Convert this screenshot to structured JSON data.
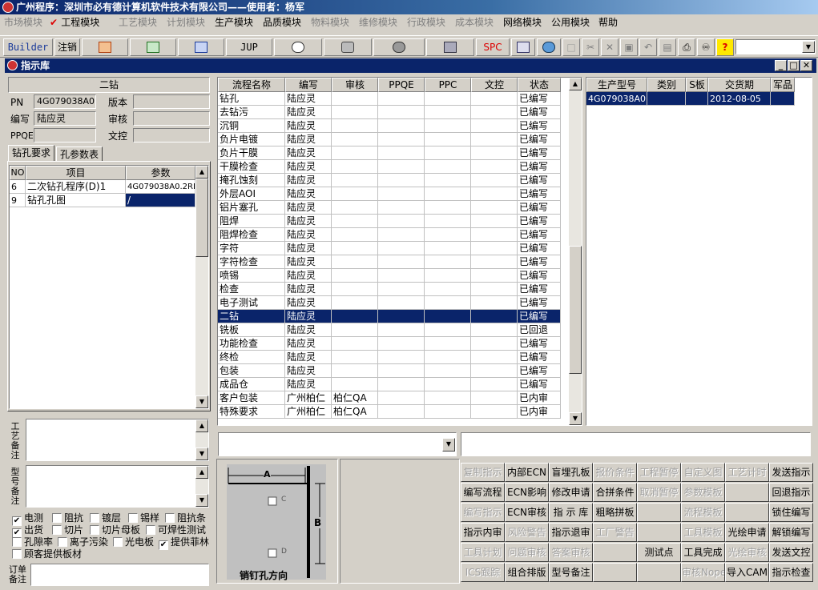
{
  "app": {
    "title": "广州程序：深圳市必有德计算机软件技术有限公司——使用者：杨军"
  },
  "menu": [
    {
      "label": "市场模块",
      "enabled": false
    },
    {
      "label": "工程模块",
      "enabled": true,
      "checked": true
    },
    {
      "label": "工艺模块",
      "enabled": false
    },
    {
      "label": "计划模块",
      "enabled": false
    },
    {
      "label": "生产模块",
      "enabled": true
    },
    {
      "label": "品质模块",
      "enabled": true
    },
    {
      "label": "物料模块",
      "enabled": false
    },
    {
      "label": "维修模块",
      "enabled": false
    },
    {
      "label": "行政模块",
      "enabled": false
    },
    {
      "label": "成本模块",
      "enabled": false
    },
    {
      "label": "网络模块",
      "enabled": true
    },
    {
      "label": "公用模块",
      "enabled": true
    },
    {
      "label": "帮助",
      "enabled": true
    }
  ],
  "toolbar": {
    "builder": "Builder",
    "logout": "注销",
    "jup": "JUP",
    "spc": "SPC"
  },
  "window": {
    "title": "指示库"
  },
  "left": {
    "heading": "二钻",
    "pn_label": "PN",
    "pn_value": "4G079038A0",
    "version_label": "版本",
    "version_value": "",
    "author_label": "编写",
    "author_value": "陆应灵",
    "review_label": "审核",
    "review_value": "",
    "ppqe_label": "PPQE",
    "ppqe_value": "",
    "doc_label": "文控",
    "doc_value": "",
    "tabs": [
      "钻孔要求",
      "孔参数表"
    ],
    "grid_headers": [
      "NO",
      "项目",
      "参数"
    ],
    "grid_rows": [
      {
        "no": "6",
        "item": "二次钻孔程序(D)1",
        "param": "4G079038A0.2RD"
      },
      {
        "no": "9",
        "item": "钻孔孔图",
        "param": "/"
      }
    ],
    "process_note_label": "工艺备注",
    "model_note_label": "型号备注",
    "order_note_label": "订单备注",
    "checks": [
      {
        "label": "电测",
        "checked": true
      },
      {
        "label": "阻抗",
        "checked": false
      },
      {
        "label": "镀层",
        "checked": false
      },
      {
        "label": "锡样",
        "checked": false
      },
      {
        "label": "阻抗条",
        "checked": false
      },
      {
        "label": "出货",
        "checked": true
      },
      {
        "label": "切片",
        "checked": false
      },
      {
        "label": "切片母板",
        "checked": false
      },
      {
        "label": "可焊性测试",
        "checked": false
      },
      {
        "label": "孔隙率",
        "checked": false
      },
      {
        "label": "离子污染",
        "checked": false
      },
      {
        "label": "光电板",
        "checked": false
      },
      {
        "label": "提供菲林",
        "checked": true
      },
      {
        "label": "顾客提供板材",
        "checked": false
      }
    ]
  },
  "process": {
    "headers": [
      "流程名称",
      "编写",
      "审核",
      "PPQE",
      "PPC",
      "文控",
      "状态"
    ],
    "rows": [
      [
        "钻孔",
        "陆应灵",
        "",
        "",
        "",
        "",
        "已编写"
      ],
      [
        "去钻污",
        "陆应灵",
        "",
        "",
        "",
        "",
        "已编写"
      ],
      [
        "沉铜",
        "陆应灵",
        "",
        "",
        "",
        "",
        "已编写"
      ],
      [
        "负片电镀",
        "陆应灵",
        "",
        "",
        "",
        "",
        "已编写"
      ],
      [
        "负片干膜",
        "陆应灵",
        "",
        "",
        "",
        "",
        "已编写"
      ],
      [
        "干膜检查",
        "陆应灵",
        "",
        "",
        "",
        "",
        "已编写"
      ],
      [
        "掩孔蚀刻",
        "陆应灵",
        "",
        "",
        "",
        "",
        "已编写"
      ],
      [
        "外层AOI",
        "陆应灵",
        "",
        "",
        "",
        "",
        "已编写"
      ],
      [
        "铝片塞孔",
        "陆应灵",
        "",
        "",
        "",
        "",
        "已编写"
      ],
      [
        "阻焊",
        "陆应灵",
        "",
        "",
        "",
        "",
        "已编写"
      ],
      [
        "阻焊检查",
        "陆应灵",
        "",
        "",
        "",
        "",
        "已编写"
      ],
      [
        "字符",
        "陆应灵",
        "",
        "",
        "",
        "",
        "已编写"
      ],
      [
        "字符检查",
        "陆应灵",
        "",
        "",
        "",
        "",
        "已编写"
      ],
      [
        "喷锡",
        "陆应灵",
        "",
        "",
        "",
        "",
        "已编写"
      ],
      [
        "检查",
        "陆应灵",
        "",
        "",
        "",
        "",
        "已编写"
      ],
      [
        "电子测试",
        "陆应灵",
        "",
        "",
        "",
        "",
        "已编写"
      ],
      [
        "二钻",
        "陆应灵",
        "",
        "",
        "",
        "",
        "已编写"
      ],
      [
        "铣板",
        "陆应灵",
        "",
        "",
        "",
        "",
        "已回退"
      ],
      [
        "功能检查",
        "陆应灵",
        "",
        "",
        "",
        "",
        "已编写"
      ],
      [
        "终检",
        "陆应灵",
        "",
        "",
        "",
        "",
        "已编写"
      ],
      [
        "包装",
        "陆应灵",
        "",
        "",
        "",
        "",
        "已编写"
      ],
      [
        "成品仓",
        "陆应灵",
        "",
        "",
        "",
        "",
        "已编写"
      ],
      [
        "客户包装",
        "广州柏仁",
        "柏仁QA",
        "",
        "",
        "",
        "已内审"
      ],
      [
        "特殊要求",
        "广州柏仁",
        "柏仁QA",
        "",
        "",
        "",
        "已内审"
      ]
    ],
    "selected_index": 16
  },
  "orders": {
    "headers": [
      "生产型号",
      "类别",
      "S板",
      "交货期",
      "军品"
    ],
    "rows": [
      [
        "4G079038A0",
        "",
        "",
        "2012-08-05",
        ""
      ]
    ]
  },
  "pin_diagram": {
    "label_a": "A",
    "label_b": "B",
    "label_c": "C",
    "label_d": "D",
    "caption": "销钉孔方向"
  },
  "actions": [
    [
      {
        "label": "复制指示",
        "enabled": false
      },
      {
        "label": "内部ECN",
        "enabled": true
      },
      {
        "label": "盲埋孔板",
        "enabled": true
      },
      {
        "label": "报价条件",
        "enabled": false
      },
      {
        "label": "工程暂停",
        "enabled": false
      },
      {
        "label": "自定义图",
        "enabled": false
      },
      {
        "label": "工艺计时",
        "enabled": false
      },
      {
        "label": "发送指示",
        "enabled": true
      }
    ],
    [
      {
        "label": "编写流程",
        "enabled": true
      },
      {
        "label": "ECN影响",
        "enabled": true
      },
      {
        "label": "修改申请",
        "enabled": true
      },
      {
        "label": "合拼条件",
        "enabled": true
      },
      {
        "label": "取消暂停",
        "enabled": false
      },
      {
        "label": "参数模板",
        "enabled": false
      },
      {
        "label": "",
        "enabled": false
      },
      {
        "label": "回退指示",
        "enabled": true
      }
    ],
    [
      {
        "label": "编写指示",
        "enabled": false
      },
      {
        "label": "ECN审核",
        "enabled": true
      },
      {
        "label": "指 示 库",
        "enabled": true
      },
      {
        "label": "粗略拼板",
        "enabled": true
      },
      {
        "label": "",
        "enabled": false
      },
      {
        "label": "流程模板",
        "enabled": false
      },
      {
        "label": "",
        "enabled": false
      },
      {
        "label": "锁住编写",
        "enabled": true
      }
    ],
    [
      {
        "label": "指示内审",
        "enabled": true
      },
      {
        "label": "风险警告",
        "enabled": false
      },
      {
        "label": "指示退审",
        "enabled": true
      },
      {
        "label": "工厂警告",
        "enabled": false
      },
      {
        "label": "",
        "enabled": false
      },
      {
        "label": "工具模板",
        "enabled": false
      },
      {
        "label": "光绘申请",
        "enabled": true
      },
      {
        "label": "解锁编写",
        "enabled": true
      }
    ],
    [
      {
        "label": "工具计划",
        "enabled": false
      },
      {
        "label": "问题审核",
        "enabled": false
      },
      {
        "label": "答案审核",
        "enabled": false
      },
      {
        "label": "",
        "enabled": false
      },
      {
        "label": "测试点",
        "enabled": true
      },
      {
        "label": "工具完成",
        "enabled": true
      },
      {
        "label": "光绘审核",
        "enabled": false
      },
      {
        "label": "发送文控",
        "enabled": true
      }
    ],
    [
      {
        "label": "ICS跟踪",
        "enabled": false
      },
      {
        "label": "组合排版",
        "enabled": true
      },
      {
        "label": "型号备注",
        "enabled": true
      },
      {
        "label": "",
        "enabled": false
      },
      {
        "label": "",
        "enabled": false
      },
      {
        "label": "审核Nope",
        "enabled": false
      },
      {
        "label": "导入CAM",
        "enabled": true
      },
      {
        "label": "指示检查",
        "enabled": true
      }
    ]
  ]
}
